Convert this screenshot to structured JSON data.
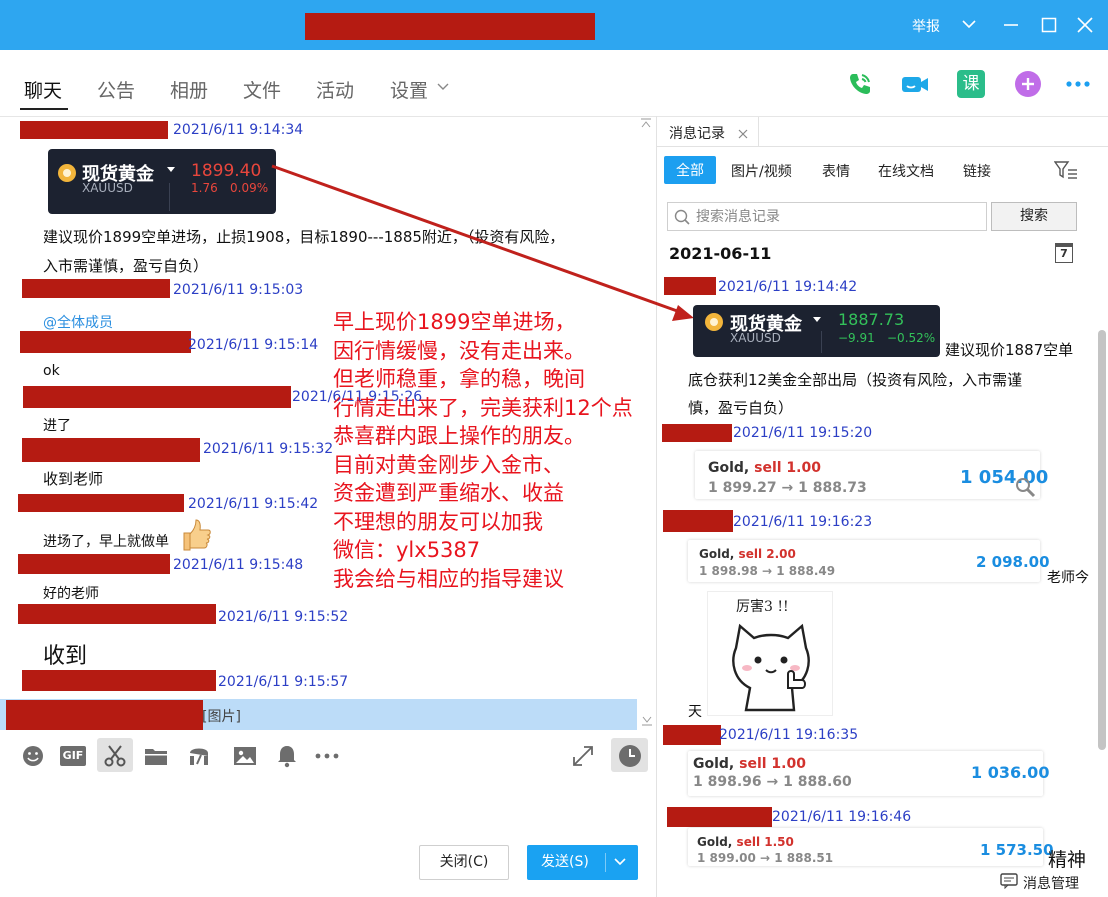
{
  "window": {
    "report_label": "举报",
    "controls": [
      "chevron-down",
      "minimize",
      "maximize",
      "close"
    ]
  },
  "nav": {
    "tabs": [
      "聊天",
      "公告",
      "相册",
      "文件",
      "活动",
      "设置"
    ],
    "active_tab": "聊天",
    "right_icons": [
      "phone-icon",
      "video-icon",
      "course-icon",
      "add-app-icon",
      "more-icon"
    ],
    "course_label": "课"
  },
  "chat": {
    "messages": [
      {
        "timestamp": "2021/6/11 9:14:34"
      },
      {
        "timestamp": "2021/6/11 9:15:03"
      },
      {
        "timestamp": "2021/6/11 9:15:14"
      },
      {
        "timestamp": "2021/6/11 9:15:26"
      },
      {
        "timestamp": "2021/6/11 9:15:32"
      },
      {
        "timestamp": "2021/6/11 9:15:42"
      },
      {
        "timestamp": "2021/6/11 9:15:48"
      },
      {
        "timestamp": "2021/6/11 9:15:52"
      },
      {
        "timestamp": "2021/6/11 9:15:57"
      }
    ],
    "gold_card": {
      "name": "现货黄金",
      "symbol": "XAUUSD",
      "price": "1899.40",
      "change": "1.76",
      "change_pct": "0.09%",
      "color": "#e8463c"
    },
    "text_advice": [
      "建议现价1899空单进场，止损1908，目标1890---1885附近，（投资有风险，",
      "入市需谨慎，盈亏自负）"
    ],
    "at_all": "@全体成员",
    "text_ok": "ok",
    "text_jinle": "进了",
    "text_shoudao_laoshi": "收到老师",
    "text_jinchang": "进场了，早上就做单",
    "text_haode": "好的老师",
    "text_shoudao": "收到",
    "image_label": "[图片]"
  },
  "overlay_text": [
    "早上现价1899空单进场，",
    "因行情缓慢，没有走出来。",
    "但老师稳重，拿的稳，晚间",
    "行情走出来了，完美获利12个点",
    "恭喜群内跟上操作的朋友。",
    "目前对黄金刚步入金市、",
    "资金遭到严重缩水、收益",
    "不理想的朋友可以加我",
    "微信：ylx5387",
    "我会给与相应的指导建议"
  ],
  "toolbar": {
    "icons": [
      "emoji-icon",
      "gif-icon",
      "scissors-icon",
      "folder-icon",
      "music-icon",
      "image-icon",
      "bell-icon",
      "more-icon"
    ],
    "gif_label": "GIF",
    "close_label": "关闭(C)",
    "send_label": "发送(S)"
  },
  "history": {
    "tab_label": "消息记录",
    "filters": [
      "全部",
      "图片/视频",
      "表情",
      "在线文档",
      "链接"
    ],
    "search_placeholder": "搜索消息记录",
    "search_button": "搜索",
    "date": "2021-06-11",
    "calendar_day": "7",
    "entries": [
      {
        "timestamp": "2021/6/11 19:14:42"
      },
      {
        "timestamp": "2021/6/11 19:15:20"
      },
      {
        "timestamp": "2021/6/11 19:16:23"
      },
      {
        "timestamp": "2021/6/11 19:16:35"
      },
      {
        "timestamp": "2021/6/11 19:16:46"
      }
    ],
    "gold_card": {
      "name": "现货黄金",
      "symbol": "XAUUSD",
      "price": "1887.73",
      "change": "−9.91",
      "change_pct": "−0.52%",
      "color": "#33c15a"
    },
    "text_advice": [
      "建议现价1887空单",
      "底仓获利12美金全部出局（投资有风险，入市需谨",
      "慎，盈亏自负）"
    ],
    "trades": [
      {
        "instrument": "Gold,",
        "side": "sell 1.00",
        "prices": "1 899.27 → 1 888.73",
        "profit": "1 054.00"
      },
      {
        "instrument": "Gold,",
        "side": "sell 2.00",
        "prices": "1 898.98 → 1 888.49",
        "profit": "2 098.00"
      },
      {
        "instrument": "Gold,",
        "side": "sell 1.00",
        "prices": "1 898.96 → 1 888.60",
        "profit": "1 036.00"
      },
      {
        "instrument": "Gold,",
        "side": "sell 1.50",
        "prices": "1 899.00 → 1 888.51",
        "profit": "1 573.50"
      }
    ],
    "text_laoshi": "老师今",
    "sticker_text": "厉害3 !!",
    "text_tian": "天",
    "text_jingshen": "精神",
    "manage_label": "消息管理"
  }
}
